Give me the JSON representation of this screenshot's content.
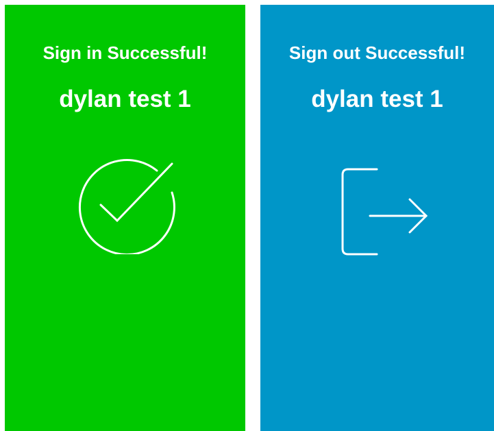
{
  "signin_screen": {
    "status": "Sign in Successful!",
    "user_name": "dylan test 1",
    "icon": "check-circle-icon",
    "background_color": "#00c800"
  },
  "signout_screen": {
    "status": "Sign out Successful!",
    "user_name": "dylan test 1",
    "icon": "sign-out-icon",
    "background_color": "#0096c8"
  }
}
